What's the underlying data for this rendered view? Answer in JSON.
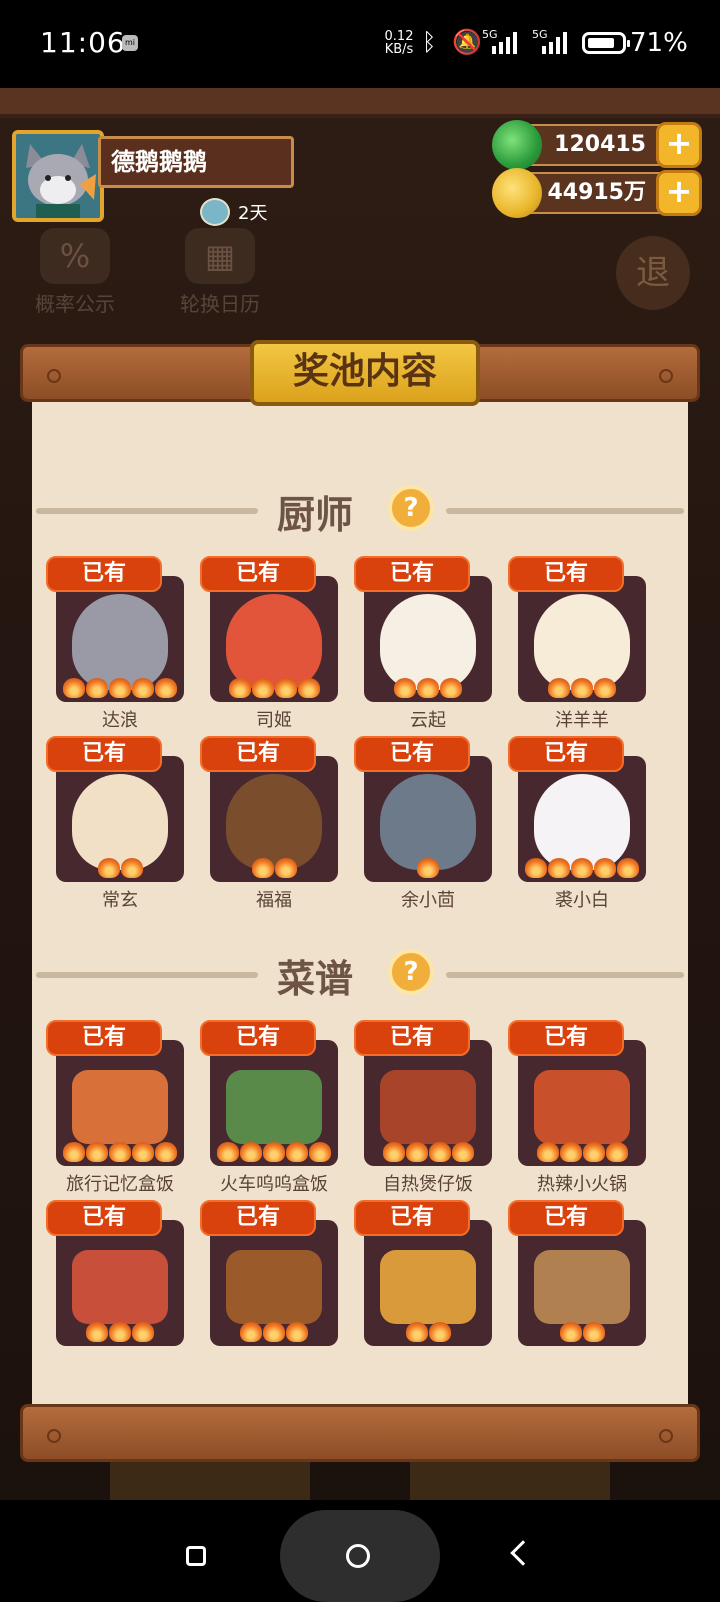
{
  "status_bar": {
    "time": "11:06",
    "speed": "0.12\nKB/s",
    "speed_top": "0.12",
    "speed_bottom": "KB/s",
    "network_1": "5G",
    "network_2": "5G",
    "battery": "71%"
  },
  "player": {
    "name": "德鹅鹅鹅",
    "days": "2天"
  },
  "currencies": {
    "jade": "120415",
    "gold": "44915万"
  },
  "background_menu": {
    "probability": "概率公示",
    "rotation_calendar": "轮换日历",
    "exit": "退"
  },
  "modal": {
    "title": "奖池内容",
    "chef_section": "厨师",
    "recipe_section": "菜谱",
    "help_label": "?",
    "owned_badge": "已有"
  },
  "chefs": [
    {
      "name": "达浪",
      "flames": 5
    },
    {
      "name": "司姬",
      "flames": 4
    },
    {
      "name": "云起",
      "flames": 3
    },
    {
      "name": "洋羊羊",
      "flames": 3
    },
    {
      "name": "常玄",
      "flames": 2
    },
    {
      "name": "福福",
      "flames": 2
    },
    {
      "name": "余小茴",
      "flames": 1
    },
    {
      "name": "裘小白",
      "flames": 5
    }
  ],
  "recipes": [
    {
      "name": "旅行记忆盒饭",
      "flames": 5
    },
    {
      "name": "火车呜呜盒饭",
      "flames": 5
    },
    {
      "name": "自热煲仔饭",
      "flames": 4
    },
    {
      "name": "热辣小火锅",
      "flames": 4
    },
    {
      "name": "",
      "flames": 3
    },
    {
      "name": "",
      "flames": 3
    },
    {
      "name": "",
      "flames": 2
    },
    {
      "name": "",
      "flames": 2
    }
  ],
  "colors": {
    "badge": "#d9420c",
    "panel": "#efe1cc",
    "card": "#48282f",
    "gold_plate": "#f2c743"
  }
}
